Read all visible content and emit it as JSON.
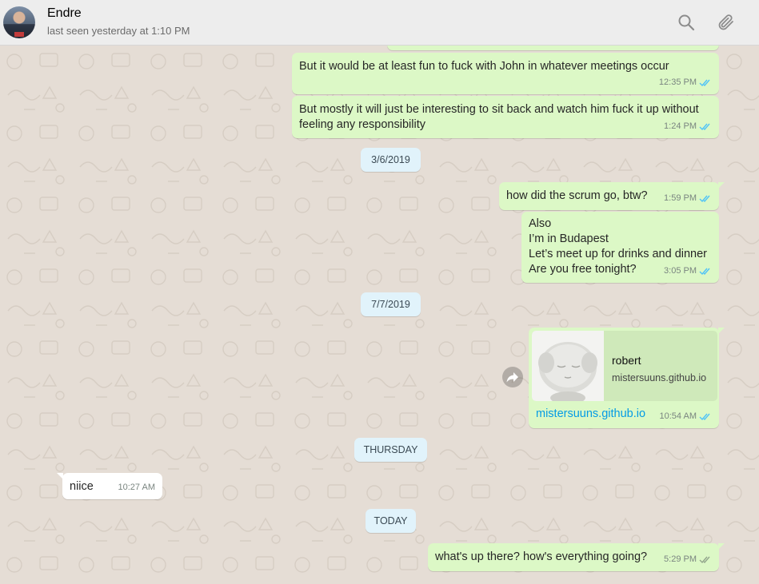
{
  "header": {
    "contact_name": "Endre",
    "status": "last seen yesterday at 1:10 PM",
    "search_icon": "search-icon",
    "attach_icon": "paperclip-icon"
  },
  "colors": {
    "outgoing_bubble": "#dcf8c6",
    "incoming_bubble": "#ffffff",
    "date_pill": "#e1f3fb",
    "read_ticks": "#4fc3f7",
    "link": "#039be5",
    "chat_background": "#e5ddd5"
  },
  "messages": [
    {
      "text": "But it would be at least fun to fuck with John in whatever meetings occur",
      "time": "12:35 PM",
      "direction": "out",
      "read": true
    },
    {
      "text": "But mostly it will just be interesting to sit back and watch him fuck it up without feeling any responsibility",
      "time": "1:24 PM",
      "direction": "out",
      "read": true
    },
    {
      "text": "how did the scrum go, btw?",
      "time": "1:59 PM",
      "direction": "out",
      "read": true
    },
    {
      "lines": [
        "Also",
        "I’m in Budapest",
        "Let’s meet up for drinks and dinner",
        "Are you free tonight?"
      ],
      "time": "3:05 PM",
      "direction": "out",
      "read": true
    },
    {
      "link_title": "robert",
      "link_domain": "mistersuuns.github.io",
      "text": "mistersuuns.github.io",
      "time": "10:54 AM",
      "direction": "out",
      "read": true
    },
    {
      "text": "niice",
      "time": "10:27 AM",
      "direction": "in"
    },
    {
      "text": "what's up there? how's everything going?",
      "time": "5:29 PM",
      "direction": "out",
      "read": false
    }
  ],
  "dates": [
    "3/6/2019",
    "7/7/2019",
    "THURSDAY",
    "TODAY"
  ]
}
